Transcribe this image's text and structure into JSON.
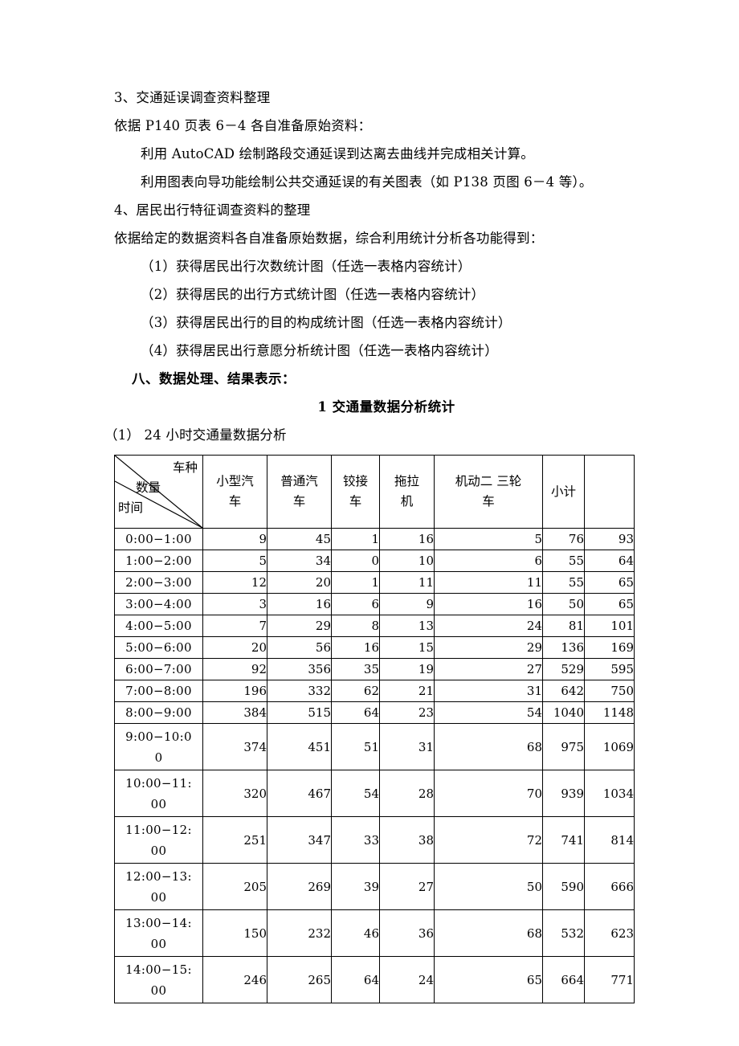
{
  "document": {
    "paragraphs": [
      {
        "id": "p1",
        "text": "3、交通延误调查资料整理",
        "style": "plain"
      },
      {
        "id": "p2",
        "text": "依据 P140 页表 6－4 各自准备原始资料：",
        "style": "plain"
      },
      {
        "id": "p3",
        "text": "利用 AutoCAD 绘制路段交通延误到达离去曲线并完成相关计算。",
        "style": "indent"
      },
      {
        "id": "p4",
        "text": "利用图表向导功能绘制公共交通延误的有关图表（如 P138 页图 6－4 等）。",
        "style": "indent"
      },
      {
        "id": "p5",
        "text": "4、居民出行特征调查资料的整理",
        "style": "plain"
      },
      {
        "id": "p6",
        "text": "依据给定的数据资料各自准备原始数据，综合利用统计分析各功能得到：",
        "style": "plain"
      },
      {
        "id": "p7",
        "text": "（1）获得居民出行次数统计图（任选一表格内容统计）",
        "style": "indent"
      },
      {
        "id": "p8",
        "text": "（2）获得居民的出行方式统计图（任选一表格内容统计）",
        "style": "indent"
      },
      {
        "id": "p9",
        "text": "（3）获得居民出行的目的构成统计图（任选一表格内容统计）",
        "style": "indent"
      },
      {
        "id": "p10",
        "text": "（4）获得居民出行意愿分析统计图（任选一表格内容统计）",
        "style": "indent"
      }
    ],
    "section_heading": "八、数据处理、结果表示：",
    "section_title": "1  交通量数据分析统计",
    "subsection_label": "（1）  24 小时交通量数据分析"
  },
  "table": {
    "corner": {
      "label_top_right": "车种",
      "label_middle": "数量",
      "label_bottom_left": "时间"
    },
    "headers": [
      {
        "line1": "小型汽",
        "line2": "车"
      },
      {
        "line1": "普通汽",
        "line2": "车"
      },
      {
        "line1": "铰接",
        "line2": "车"
      },
      {
        "line1": "拖拉",
        "line2": "机"
      },
      {
        "line1": "机动二 三轮",
        "line2": "车"
      },
      {
        "line1": "小计",
        "line2": ""
      },
      {
        "line1": "",
        "line2": ""
      }
    ],
    "rows": [
      {
        "time_l1": "0:00−1:00",
        "time_l2": "",
        "tall": false,
        "values": [
          "9",
          "45",
          "1",
          "16",
          "5",
          "76",
          "93"
        ]
      },
      {
        "time_l1": "1:00−2:00",
        "time_l2": "",
        "tall": false,
        "values": [
          "5",
          "34",
          "0",
          "10",
          "6",
          "55",
          "64"
        ]
      },
      {
        "time_l1": "2:00−3:00",
        "time_l2": "",
        "tall": false,
        "values": [
          "12",
          "20",
          "1",
          "11",
          "11",
          "55",
          "65"
        ]
      },
      {
        "time_l1": "3:00−4:00",
        "time_l2": "",
        "tall": false,
        "values": [
          "3",
          "16",
          "6",
          "9",
          "16",
          "50",
          "65"
        ]
      },
      {
        "time_l1": "4:00−5:00",
        "time_l2": "",
        "tall": false,
        "values": [
          "7",
          "29",
          "8",
          "13",
          "24",
          "81",
          "101"
        ]
      },
      {
        "time_l1": "5:00−6:00",
        "time_l2": "",
        "tall": false,
        "values": [
          "20",
          "56",
          "16",
          "15",
          "29",
          "136",
          "169"
        ]
      },
      {
        "time_l1": "6:00−7:00",
        "time_l2": "",
        "tall": false,
        "values": [
          "92",
          "356",
          "35",
          "19",
          "27",
          "529",
          "595"
        ]
      },
      {
        "time_l1": "7:00−8:00",
        "time_l2": "",
        "tall": false,
        "values": [
          "196",
          "332",
          "62",
          "21",
          "31",
          "642",
          "750"
        ]
      },
      {
        "time_l1": "8:00−9:00",
        "time_l2": "",
        "tall": false,
        "values": [
          "384",
          "515",
          "64",
          "23",
          "54",
          "1040",
          "1148"
        ]
      },
      {
        "time_l1": "9:00−10:0",
        "time_l2": "0",
        "tall": true,
        "values": [
          "374",
          "451",
          "51",
          "31",
          "68",
          "975",
          "1069"
        ]
      },
      {
        "time_l1": "10:00−11:",
        "time_l2": "00",
        "tall": true,
        "values": [
          "320",
          "467",
          "54",
          "28",
          "70",
          "939",
          "1034"
        ]
      },
      {
        "time_l1": "11:00−12:",
        "time_l2": "00",
        "tall": true,
        "values": [
          "251",
          "347",
          "33",
          "38",
          "72",
          "741",
          "814"
        ]
      },
      {
        "time_l1": "12:00−13:",
        "time_l2": "00",
        "tall": true,
        "values": [
          "205",
          "269",
          "39",
          "27",
          "50",
          "590",
          "666"
        ]
      },
      {
        "time_l1": "13:00−14:",
        "time_l2": "00",
        "tall": true,
        "values": [
          "150",
          "232",
          "46",
          "36",
          "68",
          "532",
          "623"
        ]
      },
      {
        "time_l1": "14:00−15:",
        "time_l2": "00",
        "tall": true,
        "values": [
          "246",
          "265",
          "64",
          "24",
          "65",
          "664",
          "771"
        ]
      }
    ]
  }
}
